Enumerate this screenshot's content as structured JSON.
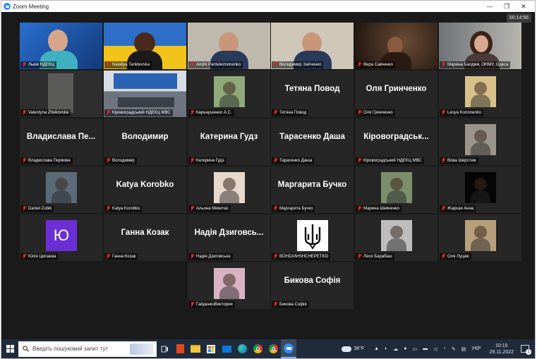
{
  "window": {
    "title": "Zoom Meeting",
    "minimize": "—",
    "maximize": "❐",
    "close": "✕"
  },
  "meeting": {
    "timer": "00:14:56"
  },
  "participants": [
    {
      "label": "Львів НДЕКЦ",
      "video": "presenter",
      "bg": "#1d5aa8"
    },
    {
      "label": "Nataliya Tanklevska",
      "video": "ukraine",
      "bg": "#2d6fc8"
    },
    {
      "label": "Andrii Panteleimonenko",
      "video": "room",
      "bg": "#bfb8ad"
    },
    {
      "label": "Володимир Зайченко",
      "video": "room2",
      "bg": "#cfc7b8"
    },
    {
      "label": "Вера Савченко",
      "video": "dark",
      "bg": "#3a2b22"
    },
    {
      "label": "Марина Балджи, ОНМУ, Одеса",
      "video": "woman",
      "bg": "#8a8c90"
    },
    {
      "label": "Valentyna Zhukovska",
      "video": "door",
      "bg": "#3c3c3c"
    },
    {
      "label": "Кіровоградський НДЕКЦ МВС",
      "video": "hall",
      "bg": "#cfd6de"
    },
    {
      "label": "Карнаушенко А.С.",
      "video": "thumb",
      "bg": "#8fa97a"
    },
    {
      "label": "Тетяна Повод",
      "name": "Тетяна Повод"
    },
    {
      "label": "Оля Гринченко",
      "name": "Оля Гринченко"
    },
    {
      "label": "Lesya Kononenko",
      "video": "thumb",
      "bg": "#d8c08a"
    },
    {
      "label": "Владислава Первова",
      "name": "Владислава  Пе..."
    },
    {
      "label": "Володимир",
      "name": "Володимир"
    },
    {
      "label": "Катерина Гудз",
      "name": "Катерина Гудз"
    },
    {
      "label": "Тарасенко Даша",
      "name": "Тарасенко Даша"
    },
    {
      "label": "Кіровоградський НДЕКЦ МВС",
      "name": "Кіровоградськ..."
    },
    {
      "label": "Вова Шерстюк",
      "video": "thumb",
      "bg": "#9a948c"
    },
    {
      "label": "Daniel Zubik",
      "video": "thumb",
      "bg": "#5a6a78"
    },
    {
      "label": "Katya Korobko",
      "name": "Katya Korobko"
    },
    {
      "label": "Альона Микитас",
      "video": "thumb",
      "bg": "#e8d8cc"
    },
    {
      "label": "Маргарита Бучко",
      "name": "Маргарита Бучко"
    },
    {
      "label": "Марина Шевченко",
      "video": "thumb",
      "bg": "#7b8f6a"
    },
    {
      "label": "Жаркая Анна",
      "video": "thumb",
      "bg": "#050505"
    },
    {
      "label": "Юлія Ципаєва",
      "avatar": "Ю"
    },
    {
      "label": "Ганна Козак",
      "name": "Ганна Козак"
    },
    {
      "label": "Надія Дзиговська",
      "name": "Надія  Дзиговсь..."
    },
    {
      "label": "BOHDAN•SHCHEPETKO",
      "video": "trident",
      "bg": "#ffffff"
    },
    {
      "label": "Леся Барабаш",
      "video": "thumb",
      "bg": "#bdbdbd"
    },
    {
      "label": "Оля Луцюк",
      "video": "thumb",
      "bg": "#b89f7c"
    },
    {
      "label": "ГайденкоВиктория",
      "video": "thumb",
      "bg": "#d9b3c4"
    },
    {
      "label": "Бикова Софія",
      "name": "Бикова Софія"
    }
  ],
  "taskbar": {
    "search_placeholder": "Введіть пошуковий запит тут",
    "weather": "38°F",
    "lang": "УКР",
    "time": "10:15",
    "date": "29.11.2022",
    "notif_count": "1"
  },
  "colors": {
    "active_border": "#e6d35e",
    "mic_muted": "#e02828",
    "taskbar": "#1f2b3a",
    "zoom_blue": "#2d8cff"
  }
}
